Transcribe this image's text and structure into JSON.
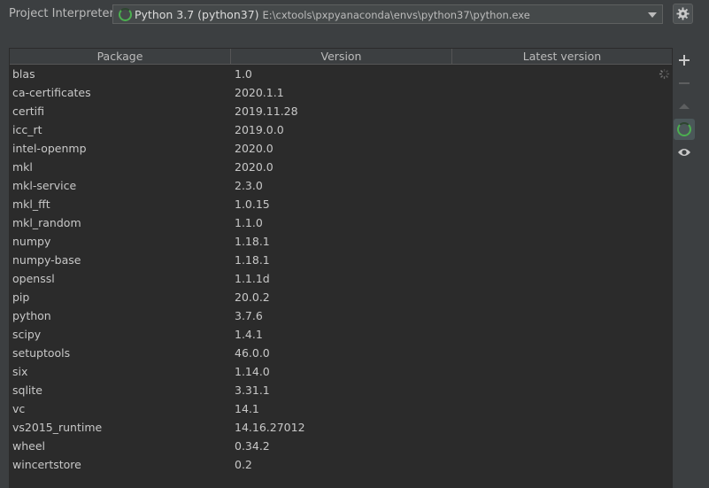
{
  "interpreter": {
    "label": "Project Interpreter:",
    "name": "Python 3.7 (python37)",
    "path": "E:\\cxtools\\pxpyanaconda\\envs\\python37\\python.exe"
  },
  "table": {
    "headers": [
      "Package",
      "Version",
      "Latest version"
    ],
    "rows": [
      {
        "package": "blas",
        "version": "1.0",
        "latest": ""
      },
      {
        "package": "ca-certificates",
        "version": "2020.1.1",
        "latest": ""
      },
      {
        "package": "certifi",
        "version": "2019.11.28",
        "latest": ""
      },
      {
        "package": "icc_rt",
        "version": "2019.0.0",
        "latest": ""
      },
      {
        "package": "intel-openmp",
        "version": "2020.0",
        "latest": ""
      },
      {
        "package": "mkl",
        "version": "2020.0",
        "latest": ""
      },
      {
        "package": "mkl-service",
        "version": "2.3.0",
        "latest": ""
      },
      {
        "package": "mkl_fft",
        "version": "1.0.15",
        "latest": ""
      },
      {
        "package": "mkl_random",
        "version": "1.1.0",
        "latest": ""
      },
      {
        "package": "numpy",
        "version": "1.18.1",
        "latest": ""
      },
      {
        "package": "numpy-base",
        "version": "1.18.1",
        "latest": ""
      },
      {
        "package": "openssl",
        "version": "1.1.1d",
        "latest": ""
      },
      {
        "package": "pip",
        "version": "20.0.2",
        "latest": ""
      },
      {
        "package": "python",
        "version": "3.7.6",
        "latest": ""
      },
      {
        "package": "scipy",
        "version": "1.4.1",
        "latest": ""
      },
      {
        "package": "setuptools",
        "version": "46.0.0",
        "latest": ""
      },
      {
        "package": "six",
        "version": "1.14.0",
        "latest": ""
      },
      {
        "package": "sqlite",
        "version": "3.31.1",
        "latest": ""
      },
      {
        "package": "vc",
        "version": "14.1",
        "latest": ""
      },
      {
        "package": "vs2015_runtime",
        "version": "14.16.27012",
        "latest": ""
      },
      {
        "package": "wheel",
        "version": "0.34.2",
        "latest": ""
      },
      {
        "package": "wincertstore",
        "version": "0.2",
        "latest": ""
      }
    ]
  },
  "toolbar": {
    "icons": [
      "plus-icon",
      "minus-icon",
      "up-icon",
      "spinner-icon",
      "eye-icon"
    ]
  },
  "colors": {
    "background": "#3c3f41",
    "table_background": "#2b2b2b",
    "accent_spinner": "#4caf50"
  }
}
